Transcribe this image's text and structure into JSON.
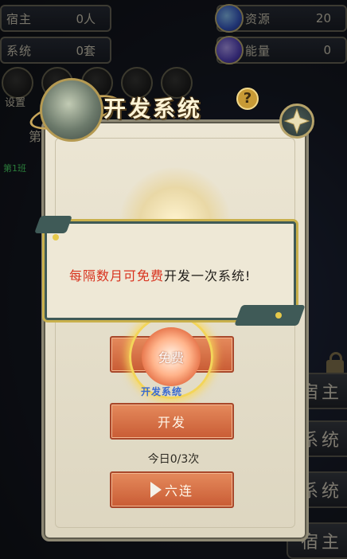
{
  "hud": {
    "resources_left": [
      {
        "label": "宿主",
        "value": "0人"
      },
      {
        "label": "系统",
        "value": "0套"
      }
    ],
    "resources_right": [
      {
        "label": "资源",
        "value": "20"
      },
      {
        "label": "能量",
        "value": "0"
      }
    ],
    "settings_label": "设置",
    "side_text": "第",
    "side_green_text": "第1班"
  },
  "right_sidebar": {
    "items": [
      "宿主",
      "系统",
      "系统",
      "宿主"
    ]
  },
  "dialog": {
    "title": "开发系统",
    "help": "?",
    "free_button": "免费",
    "free_glow_label": "免费",
    "tag_text": "开发系统",
    "develop_button": "开发",
    "today_count": "今日0/3次",
    "six_button": "六连"
  },
  "toast": {
    "message_red": "每隔数月可免费",
    "message_dark": "开发一次系统!"
  },
  "colors": {
    "accent_orange": "#d06a40",
    "toast_red": "#d8321e",
    "gold": "#c9b04c"
  }
}
